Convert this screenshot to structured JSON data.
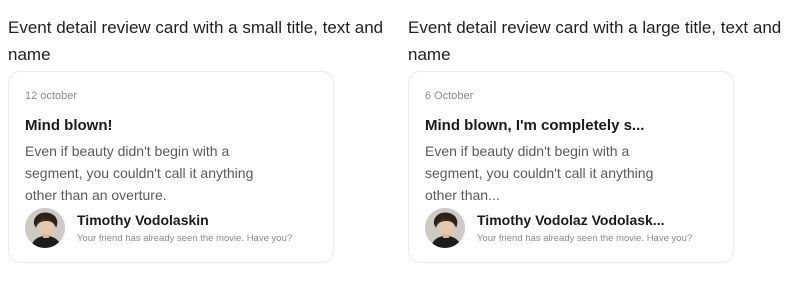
{
  "left": {
    "heading": "Event detail review card with a small title, text and name",
    "card": {
      "date": "12 october",
      "title": "Mind blown!",
      "text": "Even if beauty didn't begin with a segment, you couldn't call it anything other than an overture.",
      "author_name": "Timothy Vodolaskin",
      "author_note": "Your friend has already seen the movie. Have you?"
    }
  },
  "right": {
    "heading": "Event detail review card with a large title, text and name",
    "card": {
      "date": "6 October",
      "title": "Mind blown, I'm completely s...",
      "text": "Even if beauty didn't begin with a segment, you couldn't call it anything other than...",
      "author_name": "Timothy Vodolaz Vodolask...",
      "author_note": "Your friend has already seen the movie. Have you?"
    }
  },
  "icons": {
    "avatar": "person-avatar-photo"
  }
}
